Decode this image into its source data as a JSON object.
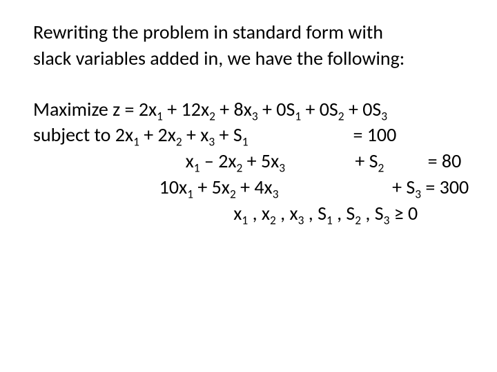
{
  "intro": {
    "line1": "Rewriting the problem in standard form with",
    "line2": "slack variables added in, we have the following:"
  },
  "ex": {
    "maximize_label": "Maximize",
    "subject_label": "subject to",
    "z_prefix": "z = 2x",
    "z_t2a": " + 12x",
    "z_t3a": " + 8x",
    "z_s1a": " + 0S",
    "z_s2a": " + 0S",
    "z_s3a": " + 0S",
    "c1_a": "2x",
    "c1_b": " + 2x",
    "c1_c": " +   x",
    "c1_d": " + S",
    "c1_eq": "=  100",
    "c2_a": "x",
    "c2_b": " – 2x",
    "c2_c": " + 5x",
    "c2_sp1": "                ",
    "c2_d": "+ S",
    "c2_eq": "=  80",
    "c3_a": "10x",
    "c3_b": " + 5x",
    "c3_c": " + 4x",
    "c3_sp1": "                          ",
    "c3_d": "+ S",
    "c3_eq": " =   300",
    "nn_a": "x",
    "nn_b": " , x",
    "nn_c": " , x",
    "nn_d": " , S",
    "nn_e": " , S",
    "nn_f": " , S",
    "nn_eq": " ≥   0",
    "sub1": "1",
    "sub2": "2",
    "sub3": "3",
    "pad_obj_left": " ",
    "pad_c1_left": "   ",
    "pad_c2_left": "        ",
    "pad_c3_left": "  ",
    "pad_nn_left": "                   ",
    "c1_sp_mid": "                        "
  }
}
